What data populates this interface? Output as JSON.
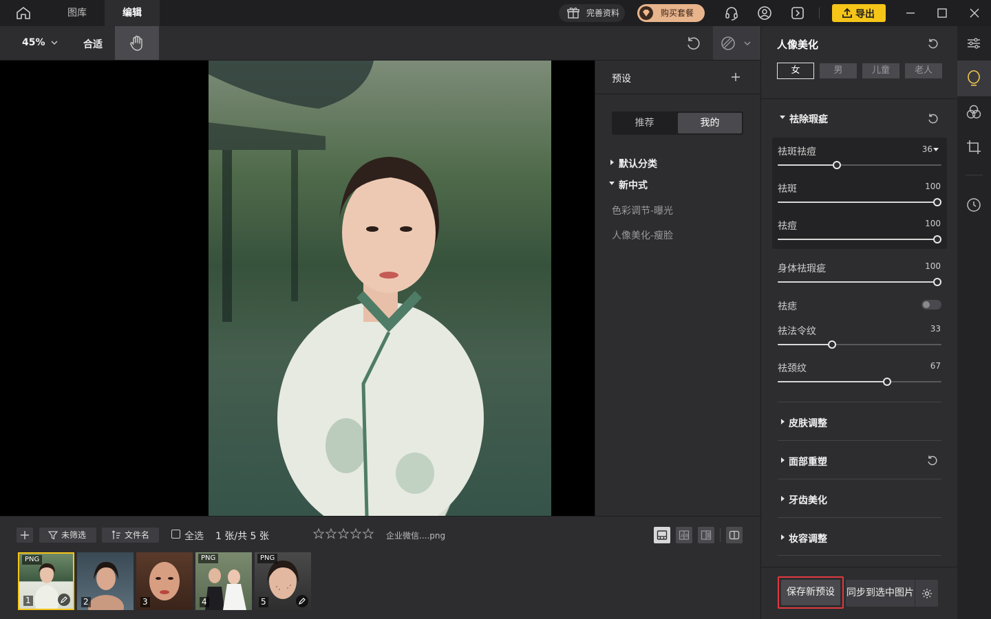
{
  "titlebar": {
    "tabs": [
      {
        "label": "图库"
      },
      {
        "label": "编辑"
      }
    ],
    "complete_info": "完善资料",
    "buy_package": "购买套餐",
    "export": "导出"
  },
  "toolbar": {
    "zoom": "45%",
    "fit": "合适"
  },
  "presets": {
    "title": "预设",
    "tabs": [
      {
        "label": "推荐"
      },
      {
        "label": "我的"
      }
    ],
    "groups": [
      {
        "label": "默认分类",
        "expanded": false
      },
      {
        "label": "新中式",
        "expanded": true,
        "items": [
          "色彩调节-曝光",
          "人像美化-瘦脸"
        ]
      }
    ]
  },
  "adjust": {
    "title": "人像美化",
    "gender_tabs": [
      {
        "label": "女"
      },
      {
        "label": "男"
      },
      {
        "label": "儿童"
      },
      {
        "label": "老人"
      }
    ],
    "section_blemish": "祛除瑕疵",
    "sliders": [
      {
        "label": "祛斑祛痘",
        "value": "36",
        "fraction": 0.36
      },
      {
        "label": "祛斑",
        "value": "100",
        "fraction": 1.0
      },
      {
        "label": "祛痘",
        "value": "100",
        "fraction": 1.0
      },
      {
        "label": "身体祛瑕疵",
        "value": "100",
        "fraction": 1.0
      },
      {
        "label": "祛法令纹",
        "value": "33",
        "fraction": 0.33
      },
      {
        "label": "祛颈纹",
        "value": "67",
        "fraction": 0.67
      }
    ],
    "toggle_mole": {
      "label": "祛痣",
      "on": false
    },
    "sections": [
      {
        "label": "皮肤调整"
      },
      {
        "label": "面部重塑"
      },
      {
        "label": "牙齿美化"
      },
      {
        "label": "妆容调整"
      }
    ],
    "save_preset": "保存新预设",
    "sync_selected": "同步到选中图片"
  },
  "bottombar": {
    "filter": "未筛选",
    "sort": "文件名",
    "select_all": "全选",
    "count": "1 张/共 5 张",
    "filename": "企业微信....png",
    "thumbnails": [
      {
        "index": "1",
        "badge": "PNG",
        "edited": true
      },
      {
        "index": "2",
        "badge": "",
        "edited": false
      },
      {
        "index": "3",
        "badge": "",
        "edited": false
      },
      {
        "index": "4",
        "badge": "PNG",
        "edited": false
      },
      {
        "index": "5",
        "badge": "PNG",
        "edited": true
      }
    ]
  },
  "colors": {
    "accent_yellow": "#f5c518",
    "highlight_red": "#e0393e",
    "active_sidebar": "#f2c94c"
  }
}
